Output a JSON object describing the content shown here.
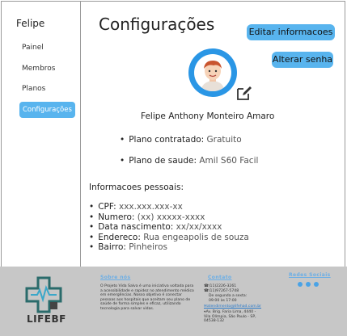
{
  "sidebar": {
    "user": "Felipe",
    "items": [
      {
        "label": "Painel"
      },
      {
        "label": "Membros"
      },
      {
        "label": "Planos"
      },
      {
        "label": "Configurações"
      }
    ]
  },
  "header": {
    "title": "Configurações",
    "edit_button": "Editar informacoes",
    "logout_button": "Alterar senha"
  },
  "profile": {
    "name": "Felipe Anthony Monteiro Amaro",
    "plan_label": "Plano contratado:",
    "plan_value": "Gratuito",
    "health_label": "Plano de saude:",
    "health_value": "Amil S60 Facil"
  },
  "personal": {
    "title": "Informacoes pessoais:",
    "fields": [
      {
        "label": "CPF:",
        "value": "xxx.xxx.xxx-xx"
      },
      {
        "label": "Numero:",
        "value": "(xx) xxxxx-xxxx"
      },
      {
        "label": "Data nascimento:",
        "value": "xx/xx/xxxx"
      },
      {
        "label": "Endereco:",
        "value": "Rua engeapolis de souza"
      },
      {
        "label": "Bairro:",
        "value": "Pinheiros"
      }
    ]
  },
  "footer": {
    "logo": "LIFEBF",
    "about_title": "Sobre nós",
    "about_text": "O Projeto Vida Salva é uma iniciativa voltada para a acessibilidade e rapidez no atendimento médico em emergências. Nosso objetivo é conectar pessoas aos hospitais que aceitam seu plano de saúde de forma simples e eficaz, utilizando tecnologia para salvar vidas.",
    "contact_title": "Contato",
    "phone1": "(11)2226-3261",
    "phone2": "(11)97267-5748",
    "hours": "De segunda a sexta: 09:00 às 17:00",
    "email": "atendimento@lifehad.com.br",
    "address": "Av. Brig. Faria Lima, 4440 - Vila Olímpia, São Paulo - SP, 04538-132",
    "social_title": "Redes Sociais"
  },
  "colors": {
    "accent": "#58b4ee",
    "avatar": "#2a96e5",
    "footer": "#c7c7c7"
  }
}
